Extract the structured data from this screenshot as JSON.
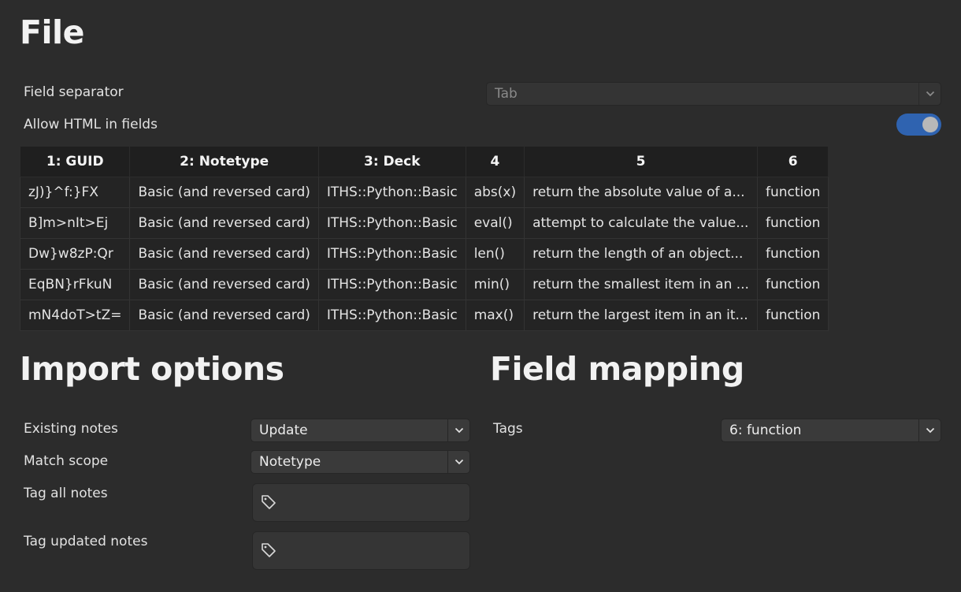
{
  "file": {
    "heading": "File",
    "field_separator": {
      "label": "Field separator",
      "value": "Tab"
    },
    "allow_html": {
      "label": "Allow HTML in fields",
      "enabled": true
    }
  },
  "preview": {
    "headers": [
      "1: GUID",
      "2: Notetype",
      "3: Deck",
      "4",
      "5",
      "6"
    ],
    "rows": [
      [
        "zJ)}^f:}FX",
        "Basic (and reversed card)",
        "ITHS::Python::Basic",
        "abs(x)",
        "return the absolute value of a...",
        "function"
      ],
      [
        "B]m>nIt>Ej",
        "Basic (and reversed card)",
        "ITHS::Python::Basic",
        "eval()",
        "attempt to calculate the value...",
        "function"
      ],
      [
        "Dw}w8zP:Qr",
        "Basic (and reversed card)",
        "ITHS::Python::Basic",
        "len()",
        "return the length of an object...",
        "function"
      ],
      [
        "EqBN}rFkuN",
        "Basic (and reversed card)",
        "ITHS::Python::Basic",
        "min()",
        "return the smallest item in an ...",
        "function"
      ],
      [
        "mN4doT>tZ=",
        "Basic (and reversed card)",
        "ITHS::Python::Basic",
        "max()",
        "return the largest item in an it...",
        "function"
      ]
    ]
  },
  "import_options": {
    "heading": "Import options",
    "existing_notes": {
      "label": "Existing notes",
      "value": "Update"
    },
    "match_scope": {
      "label": "Match scope",
      "value": "Notetype"
    },
    "tag_all_notes": {
      "label": "Tag all notes",
      "value": ""
    },
    "tag_updated_notes": {
      "label": "Tag updated notes",
      "value": ""
    }
  },
  "field_mapping": {
    "heading": "Field mapping",
    "tags": {
      "label": "Tags",
      "value": "6: function"
    }
  },
  "icons": {
    "dropdown": "chevron-down-icon",
    "tag": "tag-icon"
  },
  "colors": {
    "background": "#2c2c2c",
    "toggle_on": "#2f63b0",
    "table_header": "#1f1f1f"
  }
}
